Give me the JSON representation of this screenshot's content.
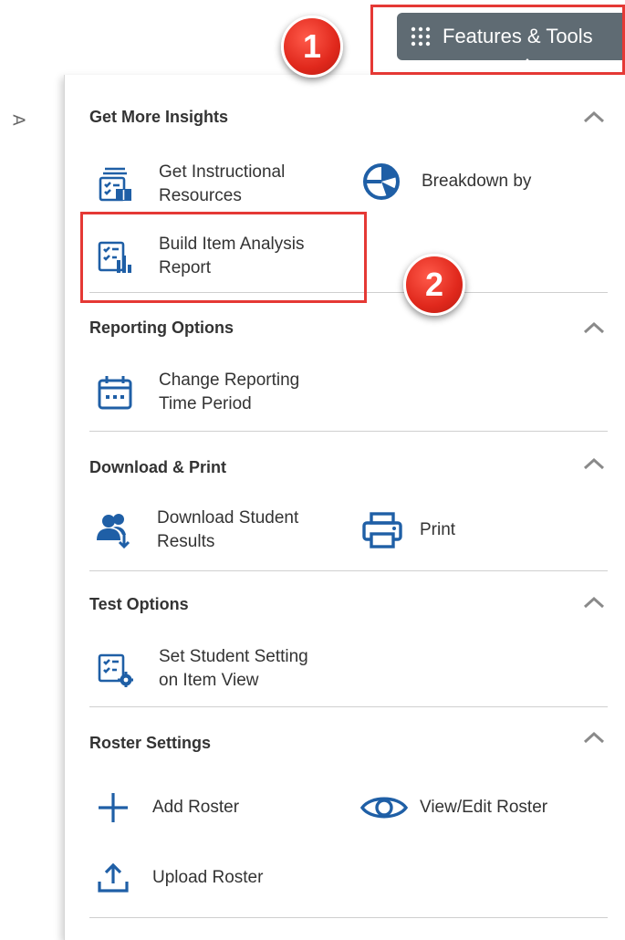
{
  "header": {
    "button_label": "Features & Tools",
    "button_icon": "grid-dots-icon"
  },
  "annotations": {
    "step_1": "1",
    "step_2": "2",
    "highlight_color": "#e53935"
  },
  "side_glyph": "A",
  "colors": {
    "icon_blue": "#1f5fa6",
    "button_bg": "#5f6b73"
  },
  "sections": [
    {
      "title": "Get More Insights",
      "items": [
        {
          "label_line1": "Get Instructional",
          "label_line2": "Resources",
          "icon": "instructional-resources-icon"
        },
        {
          "label_line1": "Breakdown by",
          "label_line2": "",
          "icon": "pie-chart-icon"
        },
        {
          "label_line1": "Build Item Analysis",
          "label_line2": "Report",
          "icon": "item-analysis-icon"
        }
      ]
    },
    {
      "title": "Reporting Options",
      "items": [
        {
          "label_line1": "Change Reporting",
          "label_line2": "Time Period",
          "icon": "calendar-icon"
        }
      ]
    },
    {
      "title": "Download & Print",
      "items": [
        {
          "label_line1": "Download Student",
          "label_line2": "Results",
          "icon": "download-users-icon"
        },
        {
          "label_line1": "Print",
          "label_line2": "",
          "icon": "printer-icon"
        }
      ]
    },
    {
      "title": "Test Options",
      "items": [
        {
          "label_line1": "Set Student Setting",
          "label_line2": "on Item View",
          "icon": "settings-checklist-icon"
        }
      ]
    },
    {
      "title": "Roster Settings",
      "items": [
        {
          "label_line1": "Add Roster",
          "label_line2": "",
          "icon": "plus-icon"
        },
        {
          "label_line1": "View/Edit Roster",
          "label_line2": "",
          "icon": "eye-icon"
        },
        {
          "label_line1": "Upload Roster",
          "label_line2": "",
          "icon": "upload-icon"
        }
      ]
    }
  ]
}
